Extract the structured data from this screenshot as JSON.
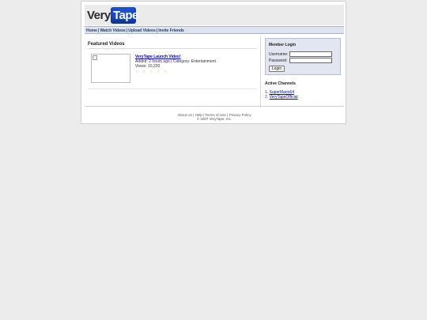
{
  "logo": {
    "very": "Very",
    "tape": "Tape"
  },
  "nav": {
    "home": "Home",
    "watch": "Watch Videos",
    "upload": "Upload Videos",
    "invite": "Invite Friends",
    "separator": "|"
  },
  "featured": {
    "title": "Featured Videos",
    "video": {
      "title": "VeryTape Launch Video!",
      "added": "Added: 2 hours ago | Category: Entertainment",
      "views": "Views: 10,220",
      "rating_stars": 5,
      "star_glyph": "☆"
    }
  },
  "login": {
    "title": "Member Login",
    "username_label": "Username:",
    "password_label": "Password:",
    "button": "Login"
  },
  "channels": {
    "title": "Active Channels",
    "items": [
      {
        "num": "1.",
        "name": "SuperMario64"
      },
      {
        "num": "2.",
        "name": "VeryTapeOfficial"
      }
    ]
  },
  "footer": {
    "links": "About Us | Help | Terms of Use | Privacy Policy",
    "copyright": "© 2007 VeryTape, Inc."
  },
  "colors": {
    "accent": "#1b4fd1",
    "link": "#0000cc",
    "nav_bg": "#dde4ee",
    "login_bg": "#e1e6f0",
    "star": "#e6a400"
  }
}
